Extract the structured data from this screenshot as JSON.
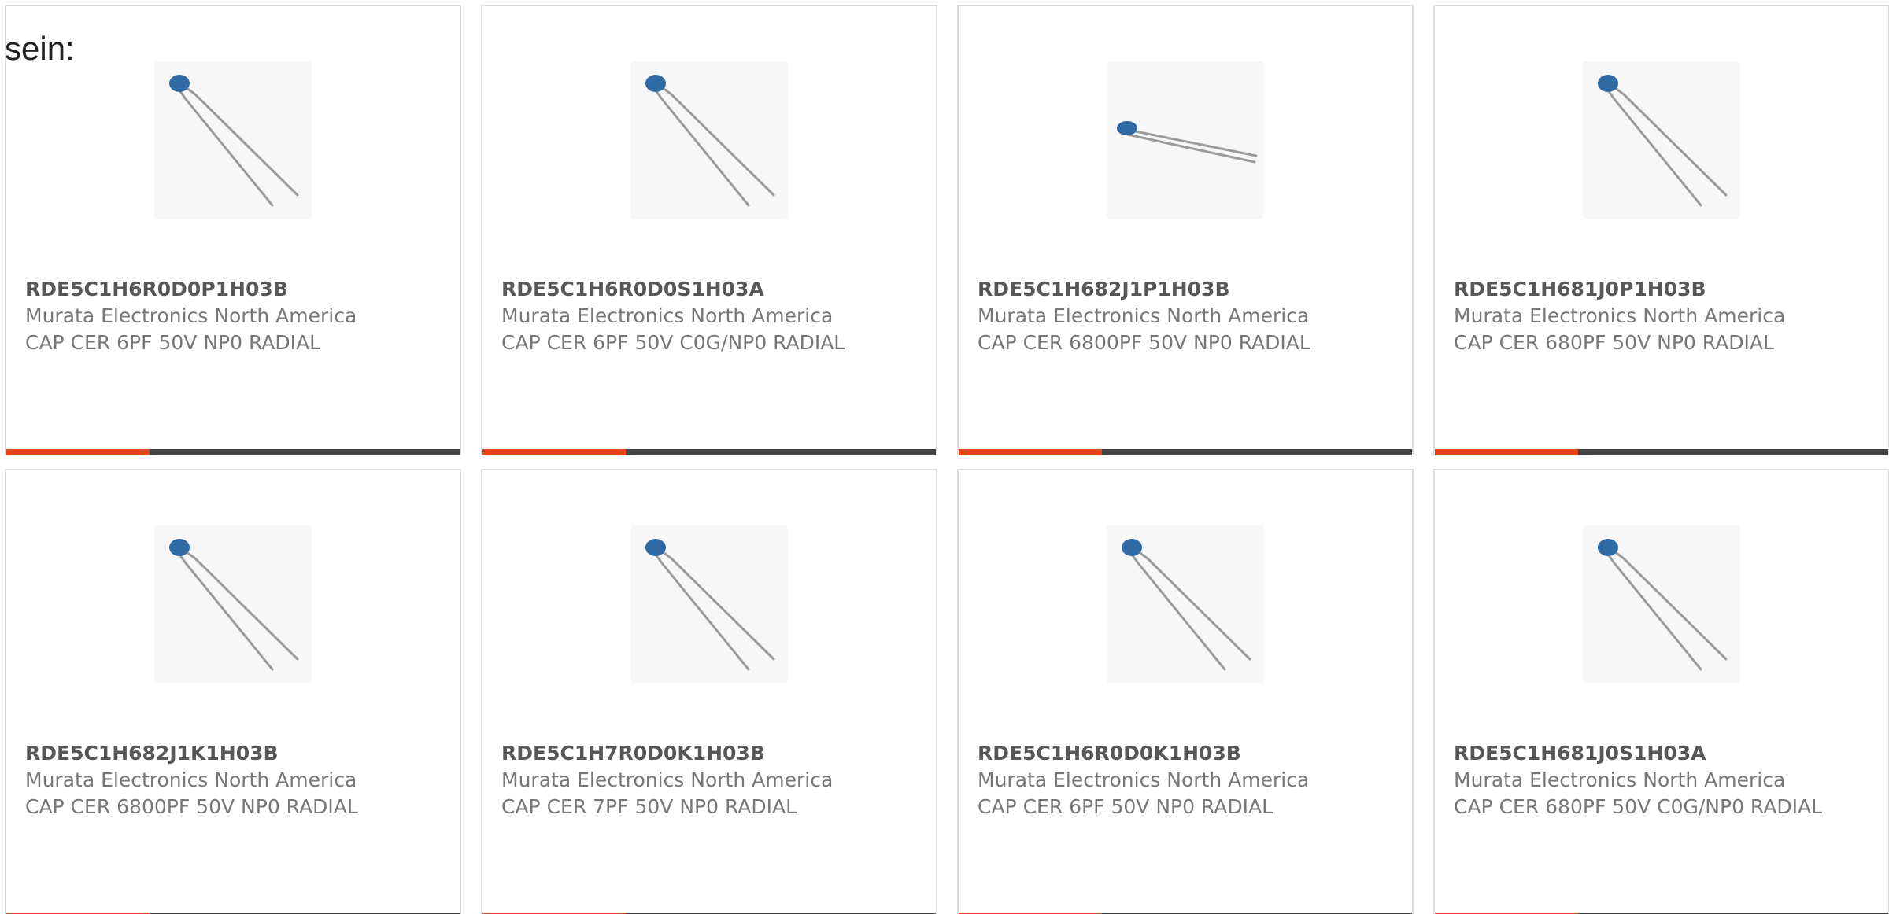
{
  "intro_text": "sein:",
  "colors": {
    "accent": "#e8431a",
    "bar": "#444444",
    "capacitor_body": "#2f6aa4",
    "lead": "#9b9b9b"
  },
  "products": [
    {
      "part": "RDE5C1H6R0D0P1H03B",
      "manufacturer": "Murata Electronics North America",
      "description": "CAP CER 6PF 50V NP0 RADIAL",
      "image_icon": "capacitor-icon",
      "orientation": "diagonal"
    },
    {
      "part": "RDE5C1H6R0D0S1H03A",
      "manufacturer": "Murata Electronics North America",
      "description": "CAP CER 6PF 50V C0G/NP0 RADIAL",
      "image_icon": "capacitor-icon",
      "orientation": "diagonal"
    },
    {
      "part": "RDE5C1H682J1P1H03B",
      "manufacturer": "Murata Electronics North America",
      "description": "CAP CER 6800PF 50V NP0 RADIAL",
      "image_icon": "capacitor-icon",
      "orientation": "flat"
    },
    {
      "part": "RDE5C1H681J0P1H03B",
      "manufacturer": "Murata Electronics North America",
      "description": "CAP CER 680PF 50V NP0 RADIAL",
      "image_icon": "capacitor-icon",
      "orientation": "diagonal"
    },
    {
      "part": "RDE5C1H682J1K1H03B",
      "manufacturer": "Murata Electronics North America",
      "description": "CAP CER 6800PF 50V NP0 RADIAL",
      "image_icon": "capacitor-icon",
      "orientation": "diagonal"
    },
    {
      "part": "RDE5C1H7R0D0K1H03B",
      "manufacturer": "Murata Electronics North America",
      "description": "CAP CER 7PF 50V NP0 RADIAL",
      "image_icon": "capacitor-icon",
      "orientation": "diagonal"
    },
    {
      "part": "RDE5C1H6R0D0K1H03B",
      "manufacturer": "Murata Electronics North America",
      "description": "CAP CER 6PF 50V NP0 RADIAL",
      "image_icon": "capacitor-icon",
      "orientation": "diagonal"
    },
    {
      "part": "RDE5C1H681J0S1H03A",
      "manufacturer": "Murata Electronics North America",
      "description": "CAP CER 680PF 50V C0G/NP0 RADIAL",
      "image_icon": "capacitor-icon",
      "orientation": "diagonal"
    }
  ]
}
